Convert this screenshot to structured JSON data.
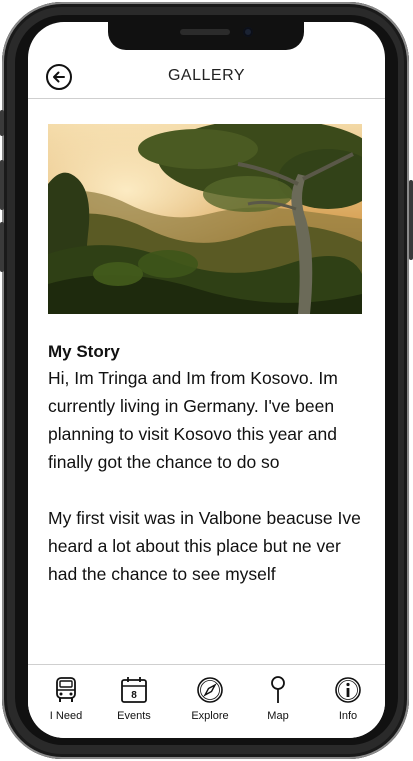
{
  "header": {
    "title": "GALLERY",
    "back_icon": "back-arrow-circle-icon"
  },
  "story": {
    "title": "My Story",
    "paragraphs": [
      "Hi, Im Tringa and Im from Kosovo. Im currently living in Germany. I've been planning to visit Kosovo this year and finally got the chance to do so",
      "My first visit was in Valbone beacuse Ive heard a lot about this place but ne ver had the chance to see myself"
    ]
  },
  "tabs": [
    {
      "label": "I Need",
      "icon": "bus-icon"
    },
    {
      "label": "Events",
      "icon": "calendar-icon",
      "calendar_day": "8"
    },
    {
      "label": "Explore",
      "icon": "compass-icon"
    },
    {
      "label": "Map",
      "icon": "map-pin-icon"
    },
    {
      "label": "Info",
      "icon": "info-icon"
    }
  ]
}
